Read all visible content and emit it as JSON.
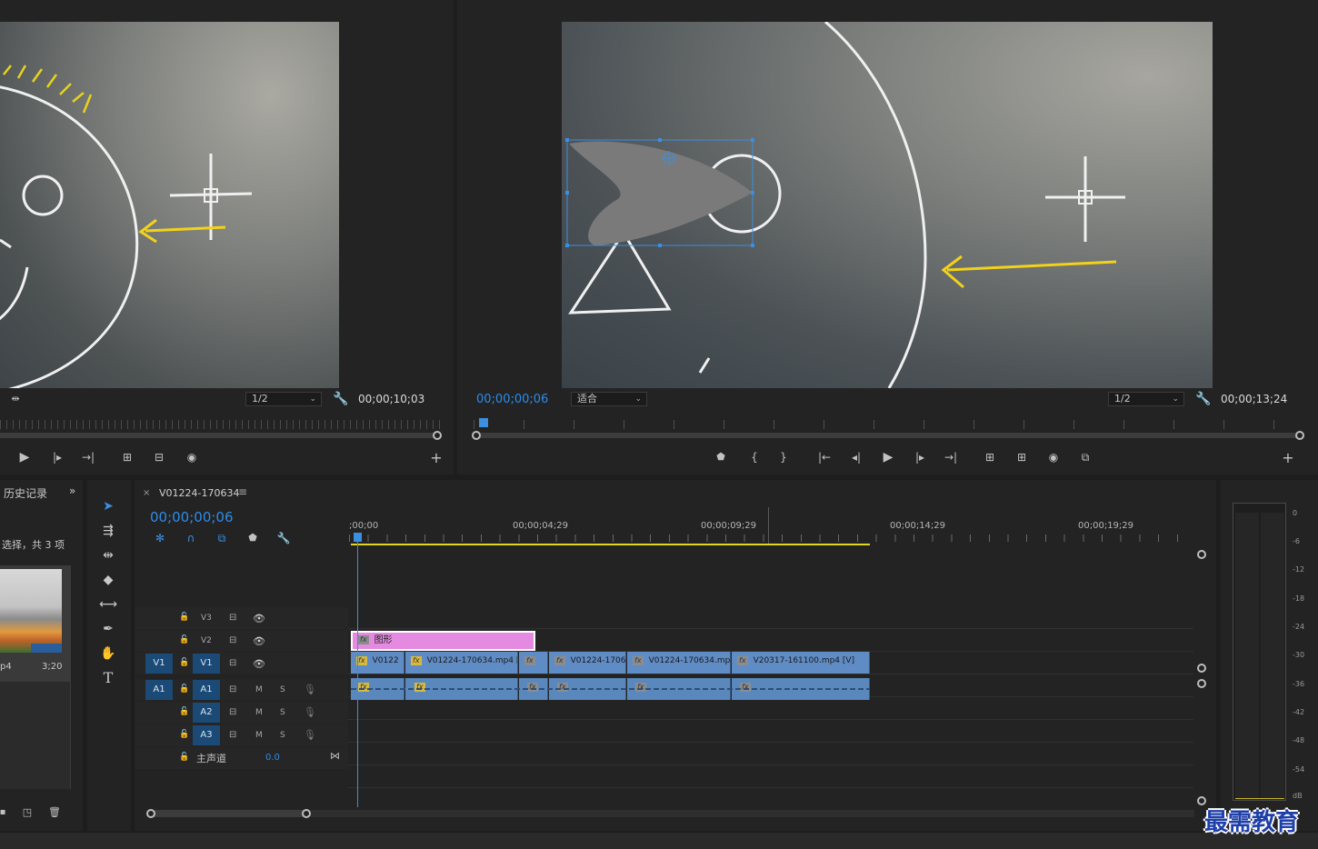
{
  "source_monitor": {
    "timecode": "00;00;10;03",
    "zoom": "1/2"
  },
  "program_monitor": {
    "current_time": "00;00;00;06",
    "fit": "适合",
    "zoom": "1/2",
    "duration": "00;00;13;24"
  },
  "history_panel": {
    "title": "历史记录",
    "status": "选择，共 3 项",
    "clip_name": "p4",
    "clip_duration": "3;20"
  },
  "timeline": {
    "sequence_name": "V01224-170634",
    "current_time": "00;00;00;06",
    "ruler": [
      ";00;00",
      "00;00;04;29",
      "00;00;09;29",
      "00;00;14;29",
      "00;00;19;29"
    ],
    "tracks": {
      "v3": "V3",
      "v2": "V2",
      "v1_target": "V1",
      "v1": "V1",
      "a1_target": "A1",
      "a1": "A1",
      "a2": "A2",
      "a3": "A3",
      "m": "M",
      "s": "S",
      "master": "主声道",
      "master_value": "0.0"
    },
    "graphic_clip": "图形",
    "video_clips": [
      "V0122",
      "V01224-170634.mp4 [",
      "",
      "V01224-1706",
      "V01224-170634.mp",
      "V20317-161100.mp4 [V]"
    ],
    "fx_label": "fx"
  },
  "meter": {
    "scale": [
      "0",
      "-6",
      "-12",
      "-18",
      "-24",
      "-30",
      "-36",
      "-42",
      "-48",
      "-54",
      "dB"
    ]
  },
  "watermark": "最需教育"
}
